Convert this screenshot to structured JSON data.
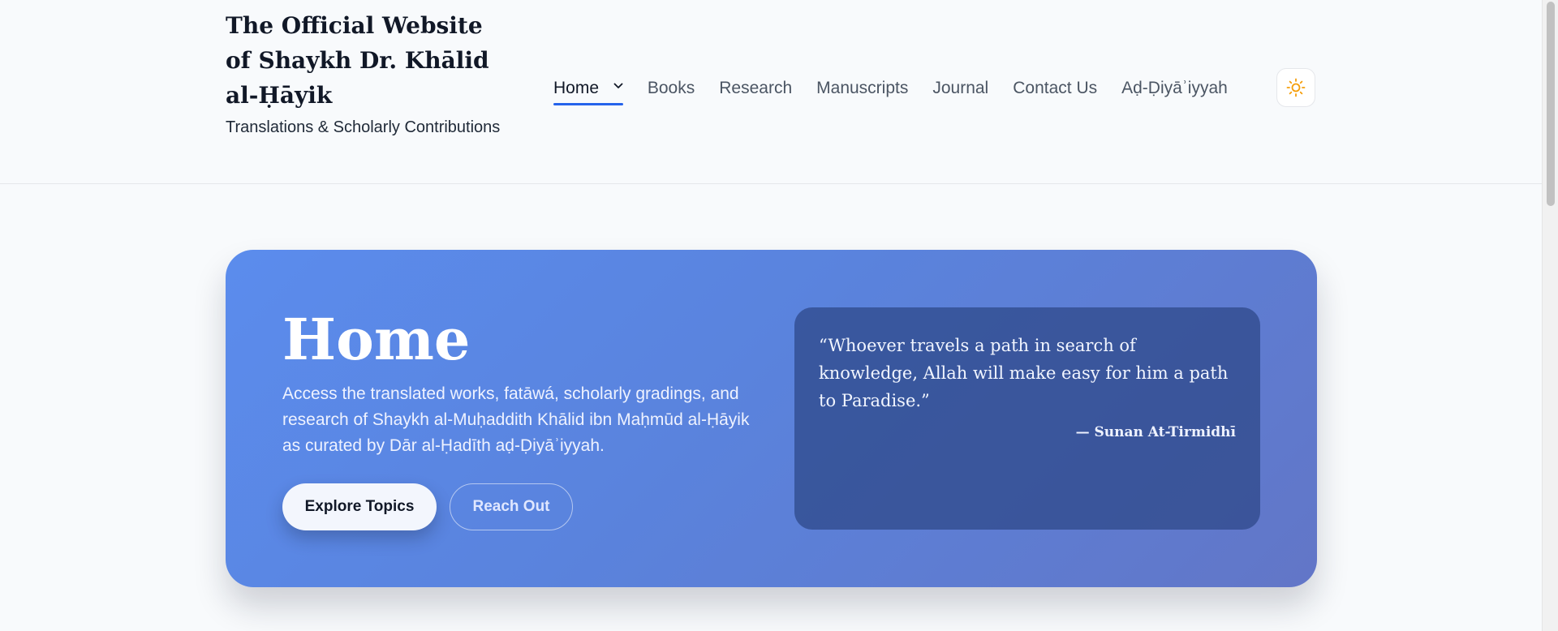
{
  "site": {
    "title": "The Official Website of Shaykh Dr. Khālid al-Ḥāyik",
    "subtitle": "Translations & Scholarly Contributions"
  },
  "nav": {
    "items": [
      {
        "label": "Home"
      },
      {
        "label": "Books"
      },
      {
        "label": "Research"
      },
      {
        "label": "Manuscripts"
      },
      {
        "label": "Journal"
      },
      {
        "label": "Contact Us"
      },
      {
        "label": "Aḍ-Ḍiyāʾiyyah"
      }
    ],
    "theme_icon": "sun-icon"
  },
  "hero": {
    "title": "Home",
    "description": "Access the translated works, fatāwá, scholarly gradings, and research of Shaykh al-Muḥaddith Khālid ibn Maḥmūd al-Ḥāyik as curated by Dār al-Ḥadīth aḍ-Ḍiyāʾiyyah.",
    "primary_button": "Explore Topics",
    "secondary_button": "Reach Out"
  },
  "quote": {
    "text": "“Whoever travels a path in search of knowledge, Allah will make easy for him a path to Paradise.”",
    "source": "— Sunan At-Tirmidhī"
  },
  "colors": {
    "accent": "#2563eb",
    "sun": "#f59e0b",
    "hero_start": "#5b8ced",
    "hero_end": "#6276c7"
  }
}
